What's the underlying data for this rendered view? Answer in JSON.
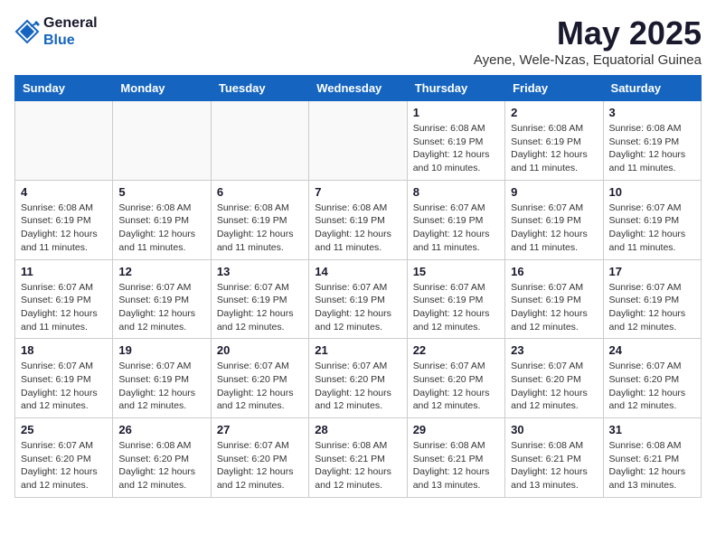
{
  "header": {
    "logo_text1": "General",
    "logo_text2": "Blue",
    "month_title": "May 2025",
    "subtitle": "Ayene, Wele-Nzas, Equatorial Guinea"
  },
  "weekdays": [
    "Sunday",
    "Monday",
    "Tuesday",
    "Wednesday",
    "Thursday",
    "Friday",
    "Saturday"
  ],
  "weeks": [
    [
      {
        "day": "",
        "info": ""
      },
      {
        "day": "",
        "info": ""
      },
      {
        "day": "",
        "info": ""
      },
      {
        "day": "",
        "info": ""
      },
      {
        "day": "1",
        "info": "Sunrise: 6:08 AM\nSunset: 6:19 PM\nDaylight: 12 hours\nand 10 minutes."
      },
      {
        "day": "2",
        "info": "Sunrise: 6:08 AM\nSunset: 6:19 PM\nDaylight: 12 hours\nand 11 minutes."
      },
      {
        "day": "3",
        "info": "Sunrise: 6:08 AM\nSunset: 6:19 PM\nDaylight: 12 hours\nand 11 minutes."
      }
    ],
    [
      {
        "day": "4",
        "info": "Sunrise: 6:08 AM\nSunset: 6:19 PM\nDaylight: 12 hours\nand 11 minutes."
      },
      {
        "day": "5",
        "info": "Sunrise: 6:08 AM\nSunset: 6:19 PM\nDaylight: 12 hours\nand 11 minutes."
      },
      {
        "day": "6",
        "info": "Sunrise: 6:08 AM\nSunset: 6:19 PM\nDaylight: 12 hours\nand 11 minutes."
      },
      {
        "day": "7",
        "info": "Sunrise: 6:08 AM\nSunset: 6:19 PM\nDaylight: 12 hours\nand 11 minutes."
      },
      {
        "day": "8",
        "info": "Sunrise: 6:07 AM\nSunset: 6:19 PM\nDaylight: 12 hours\nand 11 minutes."
      },
      {
        "day": "9",
        "info": "Sunrise: 6:07 AM\nSunset: 6:19 PM\nDaylight: 12 hours\nand 11 minutes."
      },
      {
        "day": "10",
        "info": "Sunrise: 6:07 AM\nSunset: 6:19 PM\nDaylight: 12 hours\nand 11 minutes."
      }
    ],
    [
      {
        "day": "11",
        "info": "Sunrise: 6:07 AM\nSunset: 6:19 PM\nDaylight: 12 hours\nand 11 minutes."
      },
      {
        "day": "12",
        "info": "Sunrise: 6:07 AM\nSunset: 6:19 PM\nDaylight: 12 hours\nand 12 minutes."
      },
      {
        "day": "13",
        "info": "Sunrise: 6:07 AM\nSunset: 6:19 PM\nDaylight: 12 hours\nand 12 minutes."
      },
      {
        "day": "14",
        "info": "Sunrise: 6:07 AM\nSunset: 6:19 PM\nDaylight: 12 hours\nand 12 minutes."
      },
      {
        "day": "15",
        "info": "Sunrise: 6:07 AM\nSunset: 6:19 PM\nDaylight: 12 hours\nand 12 minutes."
      },
      {
        "day": "16",
        "info": "Sunrise: 6:07 AM\nSunset: 6:19 PM\nDaylight: 12 hours\nand 12 minutes."
      },
      {
        "day": "17",
        "info": "Sunrise: 6:07 AM\nSunset: 6:19 PM\nDaylight: 12 hours\nand 12 minutes."
      }
    ],
    [
      {
        "day": "18",
        "info": "Sunrise: 6:07 AM\nSunset: 6:19 PM\nDaylight: 12 hours\nand 12 minutes."
      },
      {
        "day": "19",
        "info": "Sunrise: 6:07 AM\nSunset: 6:19 PM\nDaylight: 12 hours\nand 12 minutes."
      },
      {
        "day": "20",
        "info": "Sunrise: 6:07 AM\nSunset: 6:20 PM\nDaylight: 12 hours\nand 12 minutes."
      },
      {
        "day": "21",
        "info": "Sunrise: 6:07 AM\nSunset: 6:20 PM\nDaylight: 12 hours\nand 12 minutes."
      },
      {
        "day": "22",
        "info": "Sunrise: 6:07 AM\nSunset: 6:20 PM\nDaylight: 12 hours\nand 12 minutes."
      },
      {
        "day": "23",
        "info": "Sunrise: 6:07 AM\nSunset: 6:20 PM\nDaylight: 12 hours\nand 12 minutes."
      },
      {
        "day": "24",
        "info": "Sunrise: 6:07 AM\nSunset: 6:20 PM\nDaylight: 12 hours\nand 12 minutes."
      }
    ],
    [
      {
        "day": "25",
        "info": "Sunrise: 6:07 AM\nSunset: 6:20 PM\nDaylight: 12 hours\nand 12 minutes."
      },
      {
        "day": "26",
        "info": "Sunrise: 6:08 AM\nSunset: 6:20 PM\nDaylight: 12 hours\nand 12 minutes."
      },
      {
        "day": "27",
        "info": "Sunrise: 6:07 AM\nSunset: 6:20 PM\nDaylight: 12 hours\nand 12 minutes."
      },
      {
        "day": "28",
        "info": "Sunrise: 6:08 AM\nSunset: 6:21 PM\nDaylight: 12 hours\nand 12 minutes."
      },
      {
        "day": "29",
        "info": "Sunrise: 6:08 AM\nSunset: 6:21 PM\nDaylight: 12 hours\nand 13 minutes."
      },
      {
        "day": "30",
        "info": "Sunrise: 6:08 AM\nSunset: 6:21 PM\nDaylight: 12 hours\nand 13 minutes."
      },
      {
        "day": "31",
        "info": "Sunrise: 6:08 AM\nSunset: 6:21 PM\nDaylight: 12 hours\nand 13 minutes."
      }
    ]
  ]
}
